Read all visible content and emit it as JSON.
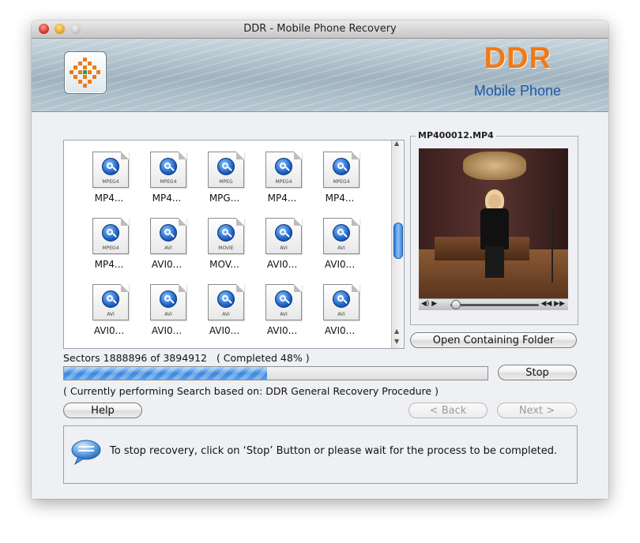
{
  "window": {
    "title": "DDR - Mobile Phone Recovery"
  },
  "banner": {
    "brand": "DDR",
    "product": "Mobile Phone"
  },
  "files": [
    {
      "name": "MP4...",
      "type": "MPEG4"
    },
    {
      "name": "MP4...",
      "type": "MPEG4"
    },
    {
      "name": "MPG...",
      "type": "MPEG"
    },
    {
      "name": "MP4...",
      "type": "MPEG4"
    },
    {
      "name": "MP4...",
      "type": "MPEG4"
    },
    {
      "name": "MP4...",
      "type": "MPEG4"
    },
    {
      "name": "AVI0...",
      "type": "AVI"
    },
    {
      "name": "MOV...",
      "type": "MOVIE"
    },
    {
      "name": "AVI0...",
      "type": "AVI"
    },
    {
      "name": "AVI0...",
      "type": "AVI"
    },
    {
      "name": "AVI0...",
      "type": "AVI"
    },
    {
      "name": "AVI0...",
      "type": "AVI"
    },
    {
      "name": "AVI0...",
      "type": "AVI"
    },
    {
      "name": "AVI0...",
      "type": "AVI"
    },
    {
      "name": "AVI0...",
      "type": "AVI"
    }
  ],
  "preview": {
    "filename": "MP400012.MP4",
    "open_folder_label": "Open Containing Folder",
    "playback_progress": 0.03
  },
  "progress": {
    "sectors_text": "Sectors 1888896 of 3894912",
    "completed_text": "( Completed 48% )",
    "percent": 48,
    "stop_label": "Stop",
    "status_text": "( Currently performing Search based on: DDR General Recovery Procedure )"
  },
  "nav": {
    "help_label": "Help",
    "back_label": "< Back",
    "next_label": "Next >"
  },
  "info": {
    "message": "To stop recovery, click on ‘Stop’ Button or please wait for the process to be completed."
  },
  "colors": {
    "brand_orange": "#ef7a1a",
    "brand_blue": "#1b5aa8",
    "progress_blue": "#3b86dc"
  }
}
